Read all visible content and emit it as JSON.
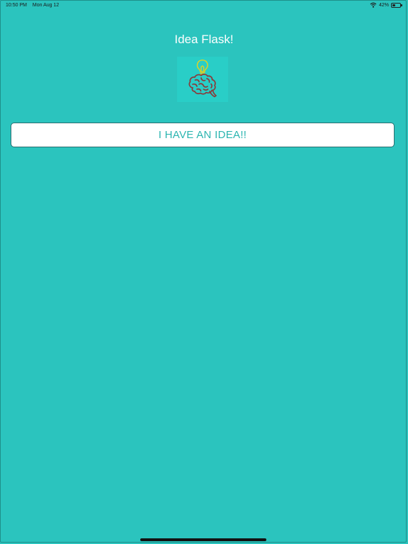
{
  "status_bar": {
    "time": "10:50 PM",
    "date": "Mon Aug 12",
    "battery_percent": "42%",
    "battery_level": 0.42,
    "icons": [
      "wifi-icon",
      "battery-icon"
    ]
  },
  "app": {
    "title": "Idea Flask!",
    "logo_icon": "lightbulb-brain-icon"
  },
  "main": {
    "idea_button_label": "I HAVE AN IDEA!!"
  },
  "colors": {
    "background": "#2bc4be",
    "logo_background": "#29cec7",
    "button_text": "#2bb5b0",
    "bulb": "#e8d21a",
    "brain": "#8a3a3a"
  }
}
